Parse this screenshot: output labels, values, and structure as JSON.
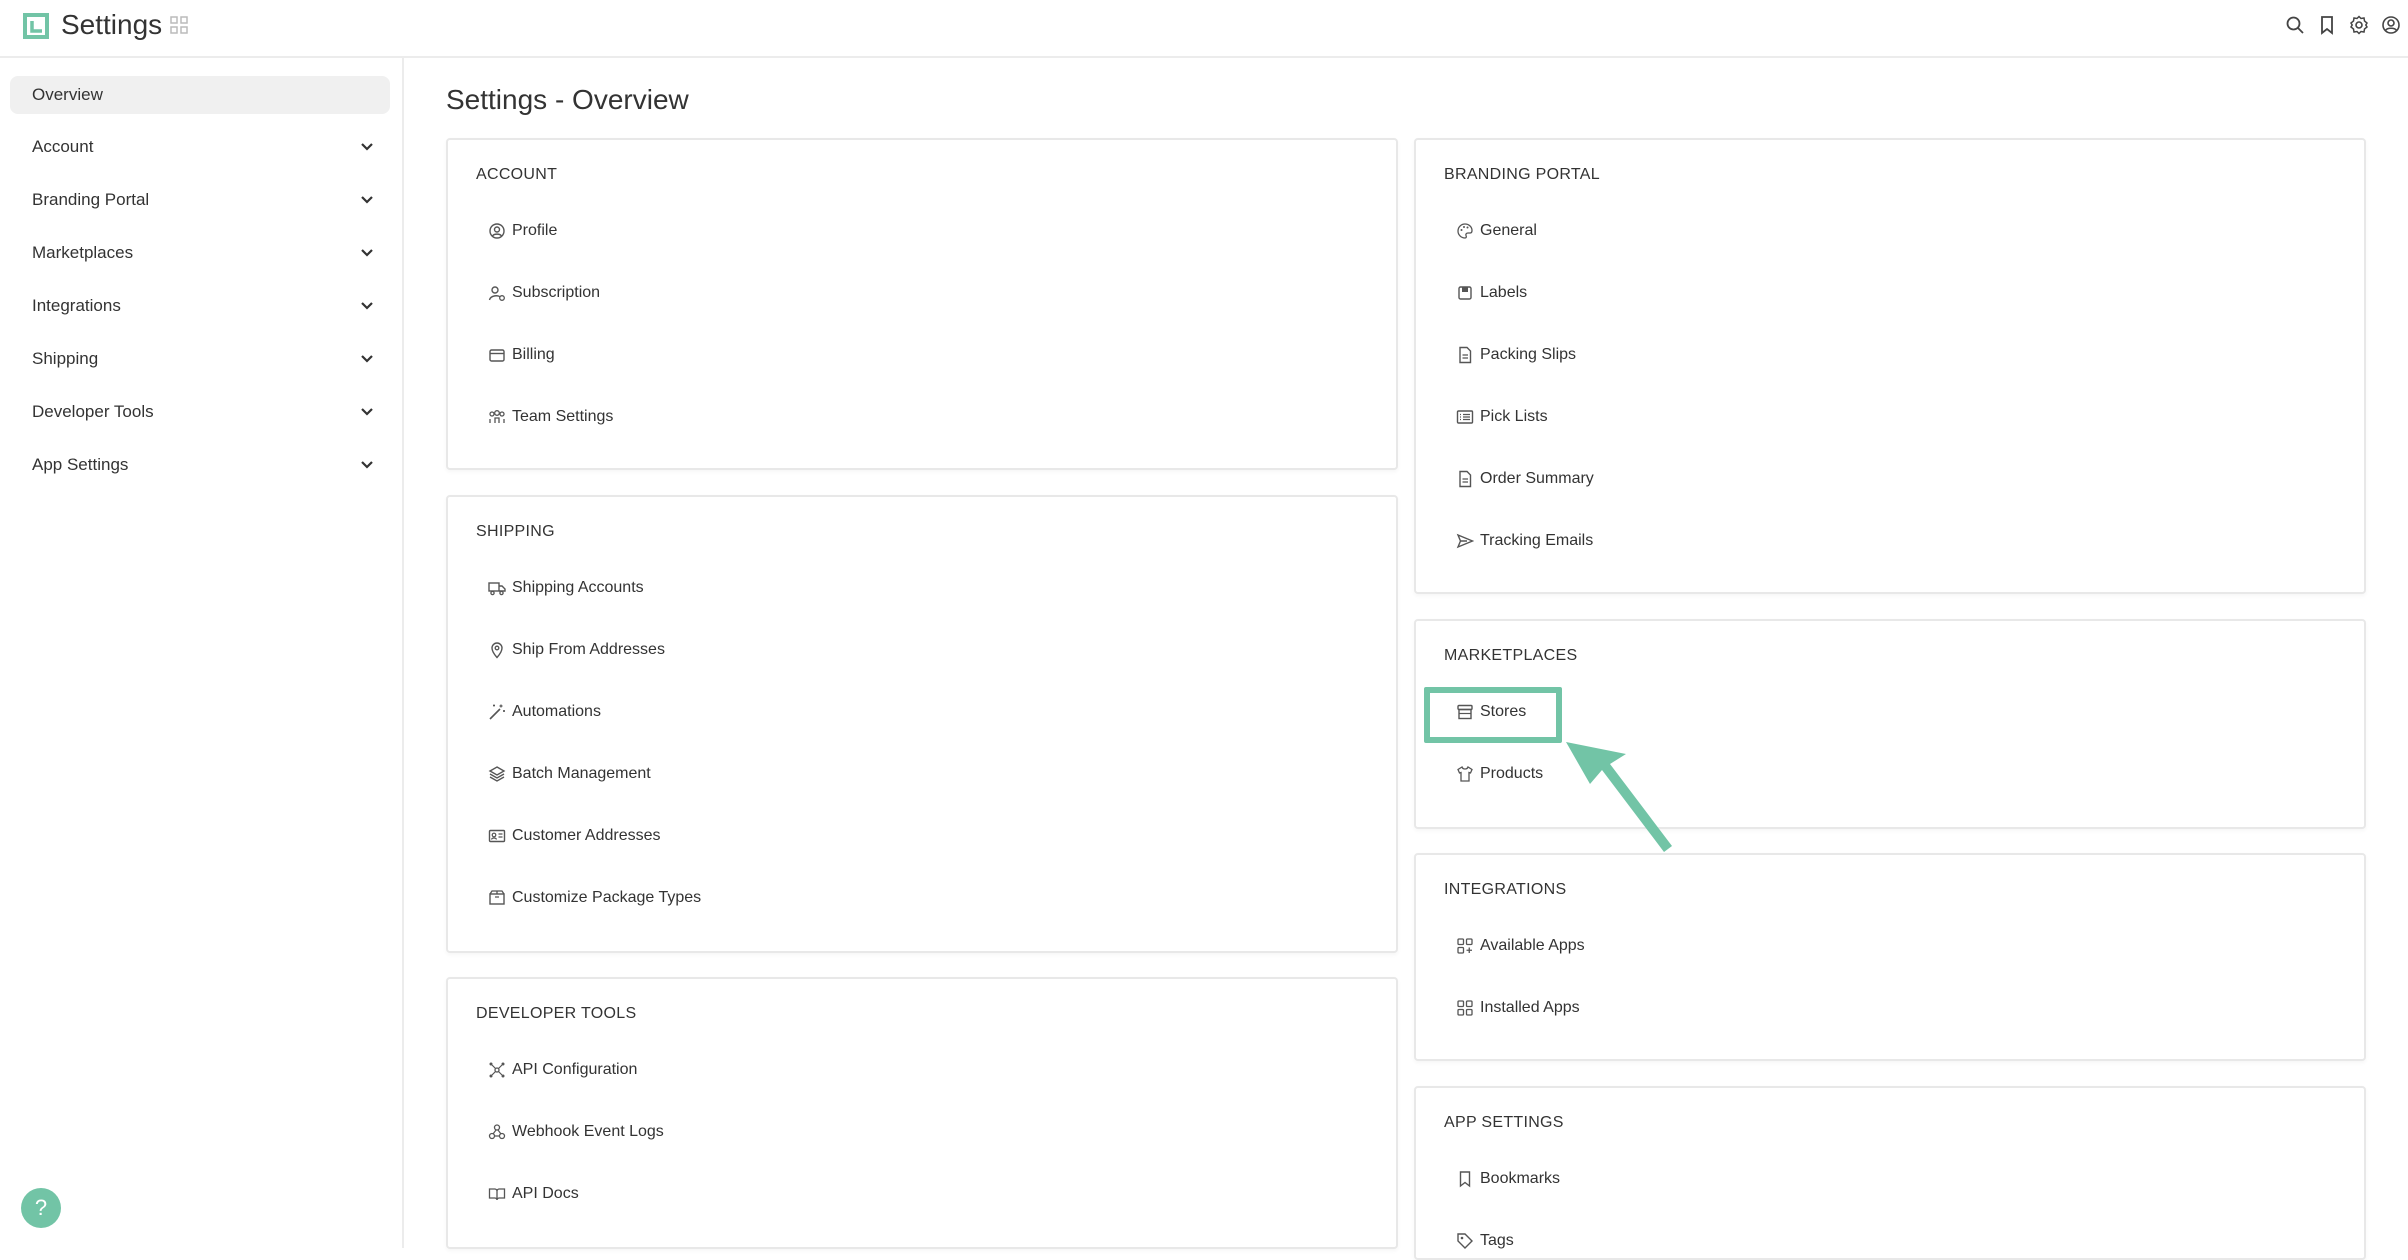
{
  "header": {
    "title": "Settings"
  },
  "sidebar": {
    "items": [
      {
        "label": "Overview",
        "active": true
      },
      {
        "label": "Account"
      },
      {
        "label": "Branding Portal"
      },
      {
        "label": "Marketplaces"
      },
      {
        "label": "Integrations"
      },
      {
        "label": "Shipping"
      },
      {
        "label": "Developer Tools"
      },
      {
        "label": "App Settings"
      }
    ],
    "help_label": "?"
  },
  "main": {
    "title": "Settings - Overview",
    "account": {
      "title": "ACCOUNT",
      "links": [
        "Profile",
        "Subscription",
        "Billing",
        "Team Settings"
      ]
    },
    "shipping": {
      "title": "SHIPPING",
      "links": [
        "Shipping Accounts",
        "Ship From Addresses",
        "Automations",
        "Batch Management",
        "Customer Addresses",
        "Customize Package Types"
      ]
    },
    "developer_tools": {
      "title": "DEVELOPER TOOLS",
      "links": [
        "API Configuration",
        "Webhook Event Logs",
        "API Docs"
      ]
    },
    "branding_portal": {
      "title": "BRANDING PORTAL",
      "links": [
        "General",
        "Labels",
        "Packing Slips",
        "Pick Lists",
        "Order Summary",
        "Tracking Emails"
      ]
    },
    "marketplaces": {
      "title": "MARKETPLACES",
      "links": [
        "Stores",
        "Products"
      ]
    },
    "integrations": {
      "title": "INTEGRATIONS",
      "links": [
        "Available Apps",
        "Installed Apps"
      ]
    },
    "app_settings": {
      "title": "APP SETTINGS",
      "links": [
        "Bookmarks",
        "Tags"
      ]
    }
  },
  "colors": {
    "accent": "#72c4a6",
    "text": "#333333",
    "border": "#e8e8e8"
  },
  "icons": [
    "search-icon",
    "bookmark-icon",
    "gear-icon",
    "user-circle-icon",
    "chevron-down-icon",
    "help-icon"
  ]
}
